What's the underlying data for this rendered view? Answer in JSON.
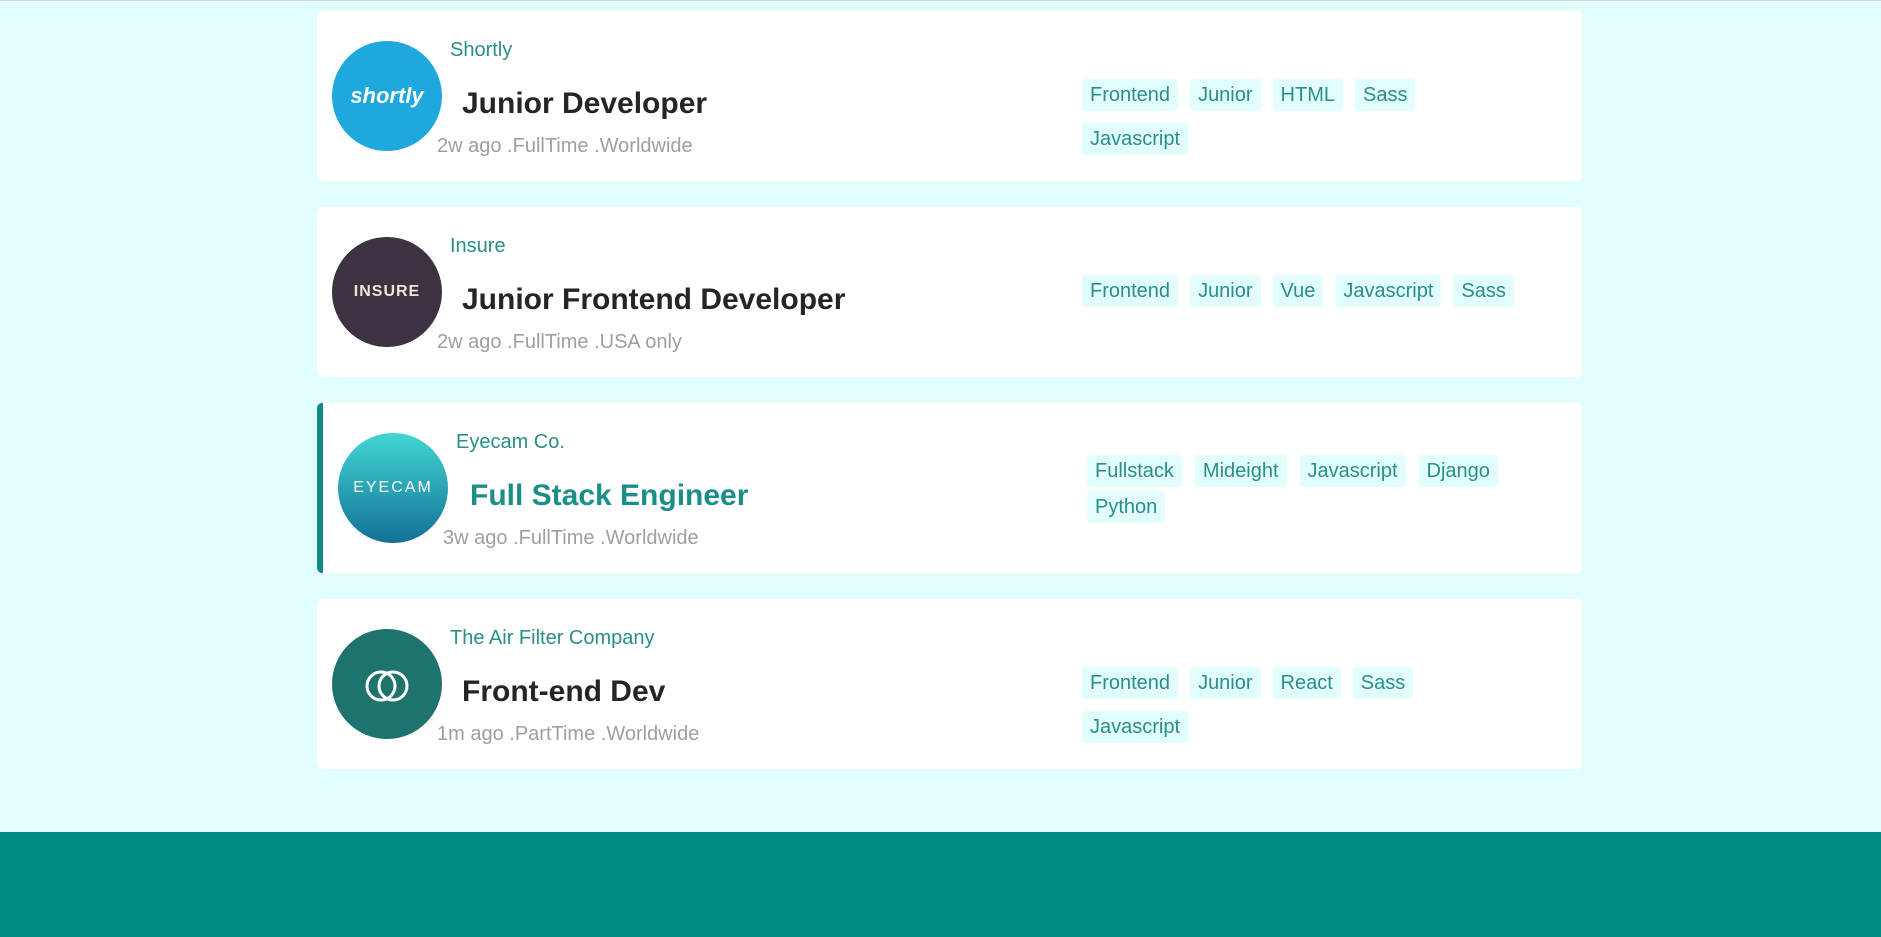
{
  "colors": {
    "page_background": "#e1fdfd",
    "card_background": "#ffffff",
    "accent": "#0e8b87",
    "company_text": "#2a8f86",
    "footer": "#008b87"
  },
  "jobs": [
    {
      "company": "Shortly",
      "logo_text": "shortly",
      "logo_icon": "shortly-logo-icon",
      "title": "Junior Developer",
      "meta": "2w ago .FullTime .Worldwide",
      "featured": false,
      "tags": [
        "Frontend",
        "Junior",
        "HTML",
        "Sass",
        "Javascript"
      ]
    },
    {
      "company": "Insure",
      "logo_text": "INSURE",
      "logo_icon": "insure-logo-icon",
      "title": "Junior Frontend Developer",
      "meta": "2w ago .FullTime .USA only",
      "featured": false,
      "tags": [
        "Frontend",
        "Junior",
        "Vue",
        "Javascript",
        "Sass"
      ]
    },
    {
      "company": "Eyecam Co.",
      "logo_text": "EYECAM",
      "logo_icon": "eyecam-logo-icon",
      "title": "Full Stack Engineer",
      "meta": "3w ago .FullTime .Worldwide",
      "featured": true,
      "tags": [
        "Fullstack",
        "Mideight",
        "Javascript",
        "Django",
        "Python"
      ]
    },
    {
      "company": "The Air Filter Company",
      "logo_text": "",
      "logo_icon": "air-filter-logo-icon",
      "title": "Front-end Dev",
      "meta": "1m ago .PartTime .Worldwide",
      "featured": false,
      "tags": [
        "Frontend",
        "Junior",
        "React",
        "Sass",
        "Javascript"
      ]
    }
  ]
}
